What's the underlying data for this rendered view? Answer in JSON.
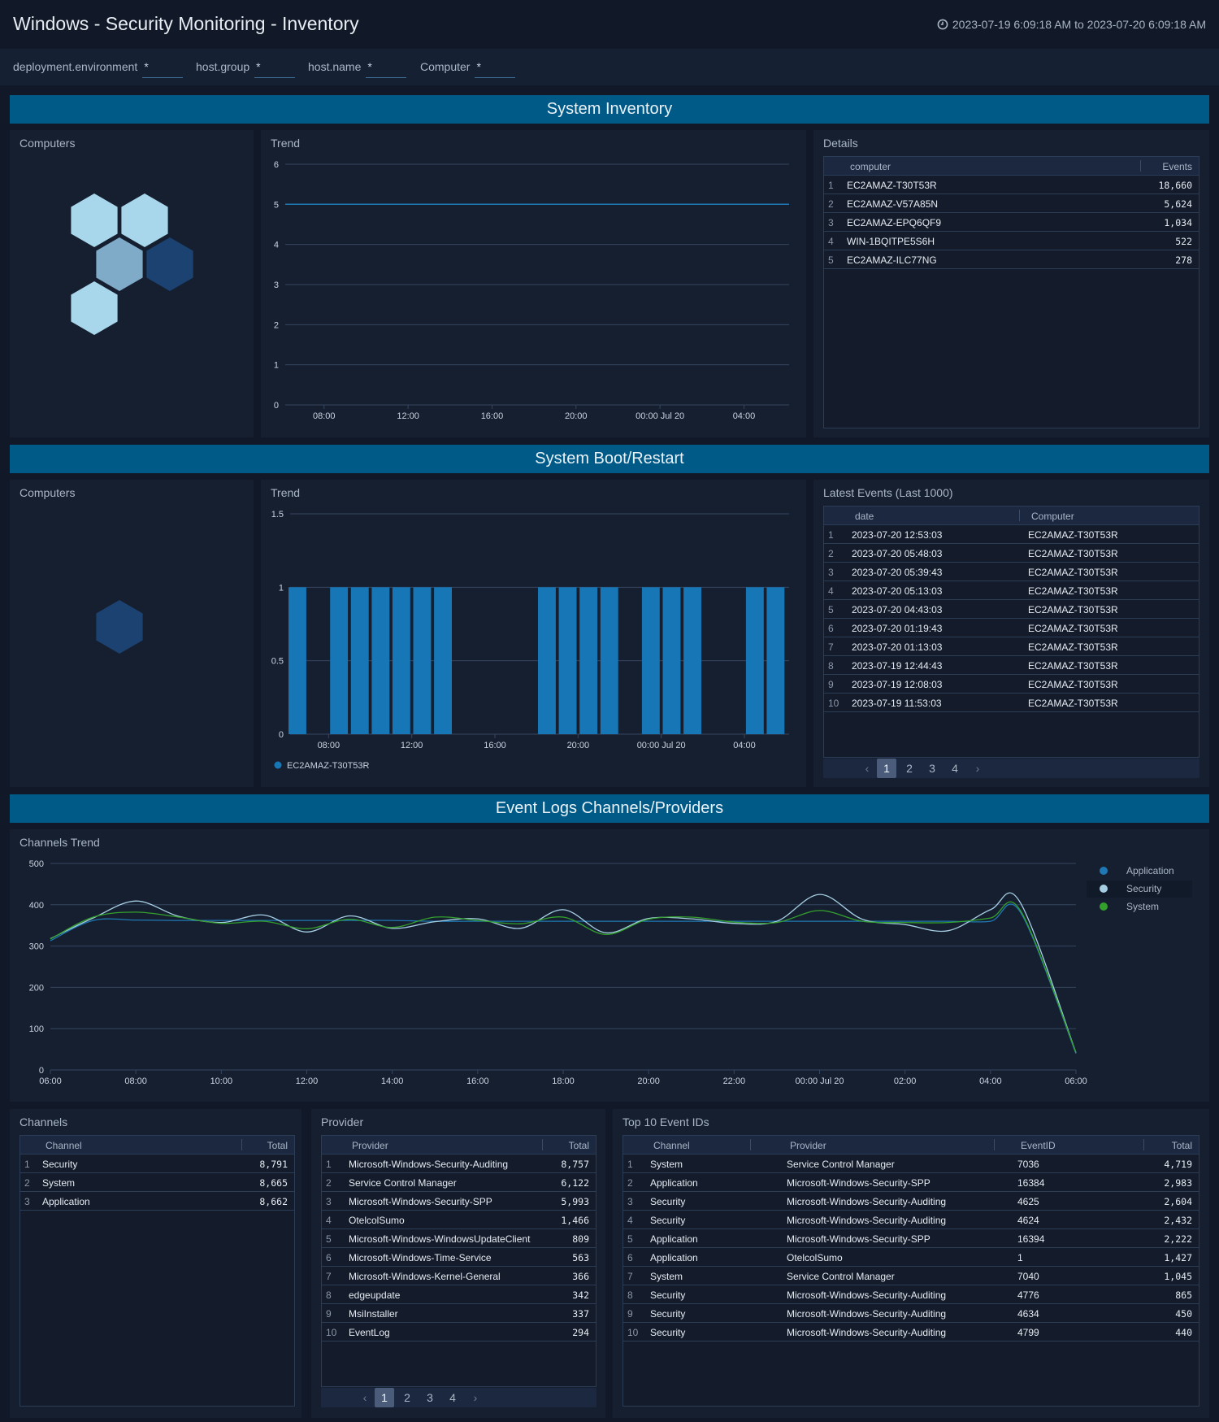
{
  "header": {
    "title": "Windows - Security Monitoring - Inventory",
    "time_range": "2023-07-19 6:09:18 AM to 2023-07-20 6:09:18 AM",
    "clock_icon": "clock-icon"
  },
  "filters": [
    {
      "label": "deployment.environment",
      "value": "*"
    },
    {
      "label": "host.group",
      "value": "*"
    },
    {
      "label": "host.name",
      "value": "*"
    },
    {
      "label": "Computer",
      "value": "*"
    }
  ],
  "sections": {
    "inventory": "System Inventory",
    "boot": "System Boot/Restart",
    "eventlogs": "Event Logs Channels/Providers"
  },
  "inventory": {
    "computers_title": "Computers",
    "honeycomb_colors": [
      "#a8d6ea",
      "#a8d6ea",
      "#7faac8",
      "#1b4270",
      "#a8d6ea"
    ],
    "trend_title": "Trend",
    "details_title": "Details",
    "details_columns": [
      "computer",
      "Events"
    ],
    "details_rows": [
      {
        "idx": "1",
        "computer": "EC2AMAZ-T30T53R",
        "events": "18,660"
      },
      {
        "idx": "2",
        "computer": "EC2AMAZ-V57A85N",
        "events": "5,624"
      },
      {
        "idx": "3",
        "computer": "EC2AMAZ-EPQ6QF9",
        "events": "1,034"
      },
      {
        "idx": "4",
        "computer": "WIN-1BQITPE5S6H",
        "events": "522"
      },
      {
        "idx": "5",
        "computer": "EC2AMAZ-ILC77NG",
        "events": "278"
      }
    ]
  },
  "boot": {
    "computers_title": "Computers",
    "honeycomb_colors": [
      "#1b4270"
    ],
    "trend_title": "Trend",
    "latest_title": "Latest Events (Last 1000)",
    "latest_columns": [
      "date",
      "Computer"
    ],
    "latest_rows": [
      {
        "idx": "1",
        "date": "2023-07-20 12:53:03",
        "computer": "EC2AMAZ-T30T53R"
      },
      {
        "idx": "2",
        "date": "2023-07-20 05:48:03",
        "computer": "EC2AMAZ-T30T53R"
      },
      {
        "idx": "3",
        "date": "2023-07-20 05:39:43",
        "computer": "EC2AMAZ-T30T53R"
      },
      {
        "idx": "4",
        "date": "2023-07-20 05:13:03",
        "computer": "EC2AMAZ-T30T53R"
      },
      {
        "idx": "5",
        "date": "2023-07-20 04:43:03",
        "computer": "EC2AMAZ-T30T53R"
      },
      {
        "idx": "6",
        "date": "2023-07-20 01:19:43",
        "computer": "EC2AMAZ-T30T53R"
      },
      {
        "idx": "7",
        "date": "2023-07-20 01:13:03",
        "computer": "EC2AMAZ-T30T53R"
      },
      {
        "idx": "8",
        "date": "2023-07-19 12:44:43",
        "computer": "EC2AMAZ-T30T53R"
      },
      {
        "idx": "9",
        "date": "2023-07-19 12:08:03",
        "computer": "EC2AMAZ-T30T53R"
      },
      {
        "idx": "10",
        "date": "2023-07-19 11:53:03",
        "computer": "EC2AMAZ-T30T53R"
      }
    ],
    "pages": [
      "1",
      "2",
      "3",
      "4"
    ],
    "active_page": "1"
  },
  "eventlogs": {
    "trend_title": "Channels Trend",
    "channels_title": "Channels",
    "channels_columns": [
      "Channel",
      "Total"
    ],
    "channels_rows": [
      {
        "idx": "1",
        "channel": "Security",
        "total": "8,791"
      },
      {
        "idx": "2",
        "channel": "System",
        "total": "8,665"
      },
      {
        "idx": "3",
        "channel": "Application",
        "total": "8,662"
      }
    ],
    "provider_title": "Provider",
    "provider_columns": [
      "Provider",
      "Total"
    ],
    "provider_rows": [
      {
        "idx": "1",
        "provider": "Microsoft-Windows-Security-Auditing",
        "total": "8,757"
      },
      {
        "idx": "2",
        "provider": "Service Control Manager",
        "total": "6,122"
      },
      {
        "idx": "3",
        "provider": "Microsoft-Windows-Security-SPP",
        "total": "5,993"
      },
      {
        "idx": "4",
        "provider": "OtelcolSumo",
        "total": "1,466"
      },
      {
        "idx": "5",
        "provider": "Microsoft-Windows-WindowsUpdateClient",
        "total": "809"
      },
      {
        "idx": "6",
        "provider": "Microsoft-Windows-Time-Service",
        "total": "563"
      },
      {
        "idx": "7",
        "provider": "Microsoft-Windows-Kernel-General",
        "total": "366"
      },
      {
        "idx": "8",
        "provider": "edgeupdate",
        "total": "342"
      },
      {
        "idx": "9",
        "provider": "MsiInstaller",
        "total": "337"
      },
      {
        "idx": "10",
        "provider": "EventLog",
        "total": "294"
      }
    ],
    "provider_pages": [
      "1",
      "2",
      "3",
      "4"
    ],
    "provider_active_page": "1",
    "top10_title": "Top 10 Event IDs",
    "top10_columns": [
      "Channel",
      "Provider",
      "EventID",
      "Total"
    ],
    "top10_rows": [
      {
        "idx": "1",
        "channel": "System",
        "provider": "Service Control Manager",
        "eventid": "7036",
        "total": "4,719"
      },
      {
        "idx": "2",
        "channel": "Application",
        "provider": "Microsoft-Windows-Security-SPP",
        "eventid": "16384",
        "total": "2,983"
      },
      {
        "idx": "3",
        "channel": "Security",
        "provider": "Microsoft-Windows-Security-Auditing",
        "eventid": "4625",
        "total": "2,604"
      },
      {
        "idx": "4",
        "channel": "Security",
        "provider": "Microsoft-Windows-Security-Auditing",
        "eventid": "4624",
        "total": "2,432"
      },
      {
        "idx": "5",
        "channel": "Application",
        "provider": "Microsoft-Windows-Security-SPP",
        "eventid": "16394",
        "total": "2,222"
      },
      {
        "idx": "6",
        "channel": "Application",
        "provider": "OtelcolSumo",
        "eventid": "1",
        "total": "1,427"
      },
      {
        "idx": "7",
        "channel": "System",
        "provider": "Service Control Manager",
        "eventid": "7040",
        "total": "1,045"
      },
      {
        "idx": "8",
        "channel": "Security",
        "provider": "Microsoft-Windows-Security-Auditing",
        "eventid": "4776",
        "total": "865"
      },
      {
        "idx": "9",
        "channel": "Security",
        "provider": "Microsoft-Windows-Security-Auditing",
        "eventid": "4634",
        "total": "450"
      },
      {
        "idx": "10",
        "channel": "Security",
        "provider": "Microsoft-Windows-Security-Auditing",
        "eventid": "4799",
        "total": "440"
      }
    ]
  },
  "chart_data": [
    {
      "id": "inventory-trend",
      "type": "line",
      "title": "Trend",
      "x_start_hour": 6.15,
      "x_end_hour": 30.15,
      "x_ticks": [
        {
          "hour": 8,
          "label": "08:00"
        },
        {
          "hour": 12,
          "label": "12:00"
        },
        {
          "hour": 16,
          "label": "16:00"
        },
        {
          "hour": 20,
          "label": "20:00"
        },
        {
          "hour": 24,
          "label": "00:00 Jul 20"
        },
        {
          "hour": 28,
          "label": "04:00"
        }
      ],
      "y_ticks": [
        0,
        1,
        2,
        3,
        4,
        5,
        6
      ],
      "ylim": [
        0,
        6
      ],
      "series": [
        {
          "name": "computers",
          "color": "#1f78b4",
          "x": [
            6.15,
            30.15
          ],
          "values": [
            5,
            5
          ]
        }
      ],
      "grid": true
    },
    {
      "id": "boot-trend",
      "type": "bar",
      "title": "Trend",
      "x_start_hour": 6.15,
      "x_end_hour": 30.15,
      "x_ticks": [
        {
          "hour": 8,
          "label": "08:00"
        },
        {
          "hour": 12,
          "label": "12:00"
        },
        {
          "hour": 16,
          "label": "16:00"
        },
        {
          "hour": 20,
          "label": "20:00"
        },
        {
          "hour": 24,
          "label": "00:00 Jul 20"
        },
        {
          "hour": 28,
          "label": "04:00"
        }
      ],
      "y_ticks": [
        0,
        0.5,
        1,
        1.5
      ],
      "y_tick_labels": [
        "0",
        "0.5",
        "1",
        "1.5"
      ],
      "ylim": [
        0,
        1.5
      ],
      "bucket_hours": 0.95,
      "series": [
        {
          "name": "EC2AMAZ-T30T53R",
          "color": "#1776b6",
          "x": [
            6.5,
            8.5,
            9.5,
            10.5,
            11.5,
            12.5,
            13.5,
            18.5,
            19.5,
            20.5,
            21.5,
            23.5,
            24.5,
            25.5,
            28.5,
            29.5
          ],
          "values": [
            1,
            1,
            1,
            1,
            1,
            1,
            1,
            1,
            1,
            1,
            1,
            1,
            1,
            1,
            1,
            1
          ]
        }
      ],
      "legend": "bottom-left",
      "grid": true
    },
    {
      "id": "channels-trend",
      "type": "line",
      "title": "Channels Trend",
      "x_start_hour": 6,
      "x_end_hour": 30,
      "x_ticks": [
        {
          "hour": 6,
          "label": "06:00"
        },
        {
          "hour": 8,
          "label": "08:00"
        },
        {
          "hour": 10,
          "label": "10:00"
        },
        {
          "hour": 12,
          "label": "12:00"
        },
        {
          "hour": 14,
          "label": "14:00"
        },
        {
          "hour": 16,
          "label": "16:00"
        },
        {
          "hour": 18,
          "label": "18:00"
        },
        {
          "hour": 20,
          "label": "20:00"
        },
        {
          "hour": 22,
          "label": "22:00"
        },
        {
          "hour": 24,
          "label": "00:00 Jul 20"
        },
        {
          "hour": 26,
          "label": "02:00"
        },
        {
          "hour": 28,
          "label": "04:00"
        },
        {
          "hour": 30,
          "label": "06:00"
        }
      ],
      "y_ticks": [
        0,
        100,
        200,
        300,
        400,
        500
      ],
      "ylim": [
        0,
        500
      ],
      "legend": "right",
      "grid": true,
      "x": [
        6,
        7,
        8,
        9,
        10,
        11,
        12,
        13,
        14,
        15,
        16,
        17,
        18,
        19,
        20,
        21,
        22,
        23,
        24,
        25,
        26,
        27,
        28,
        28.7,
        30
      ],
      "series": [
        {
          "name": "Application",
          "color": "#1f78b4",
          "values": [
            313,
            362,
            363,
            362,
            362,
            362,
            362,
            362,
            362,
            360,
            360,
            360,
            360,
            360,
            360,
            360,
            360,
            360,
            360,
            360,
            360,
            360,
            360,
            382,
            40
          ]
        },
        {
          "name": "Security",
          "color": "#a6cee3",
          "values": [
            318,
            368,
            409,
            372,
            357,
            375,
            334,
            373,
            343,
            359,
            366,
            343,
            388,
            332,
            367,
            366,
            355,
            360,
            425,
            365,
            352,
            337,
            388,
            405,
            42
          ]
        },
        {
          "name": "System",
          "color": "#33a02c",
          "values": [
            317,
            370,
            382,
            370,
            355,
            360,
            342,
            365,
            345,
            370,
            362,
            354,
            370,
            328,
            365,
            370,
            358,
            357,
            386,
            360,
            357,
            357,
            368,
            386,
            42
          ]
        }
      ]
    }
  ]
}
